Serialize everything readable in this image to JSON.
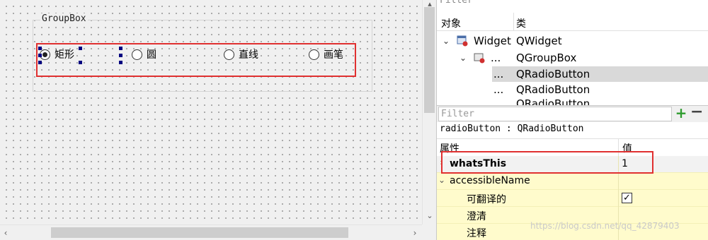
{
  "canvas": {
    "groupbox_title": "GroupBox",
    "radios": [
      {
        "label": "矩形",
        "checked": true
      },
      {
        "label": "圆",
        "checked": false
      },
      {
        "label": "直线",
        "checked": false
      },
      {
        "label": "画笔",
        "checked": false
      }
    ]
  },
  "object_inspector": {
    "filter_label": "Filter",
    "header": {
      "object": "对象",
      "class": "类"
    },
    "rows": [
      {
        "name": "Widget",
        "class": "QWidget"
      },
      {
        "name": "...",
        "class": "QGroupBox"
      },
      {
        "name": "...",
        "class": "QRadioButton"
      },
      {
        "name": "...",
        "class": "QRadioButton"
      },
      {
        "name": "",
        "class": "QRadioButton"
      }
    ]
  },
  "property_editor": {
    "filter_placeholder": "Filter",
    "object_name": "radioButton : QRadioButton",
    "header": {
      "property": "属性",
      "value": "值"
    },
    "rows": [
      {
        "name": "whatsThis",
        "value": "1"
      },
      {
        "name": "accessibleName",
        "value": ""
      },
      {
        "name": "可翻译的",
        "value": "✓"
      },
      {
        "name": "澄清",
        "value": ""
      },
      {
        "name": "注释",
        "value": ""
      }
    ]
  },
  "watermark": "https://blog.csdn.net/qq_42879403",
  "colors": {
    "highlight": "#e03030",
    "selection_handle": "#000080",
    "property_bg": "#fffbcc"
  }
}
